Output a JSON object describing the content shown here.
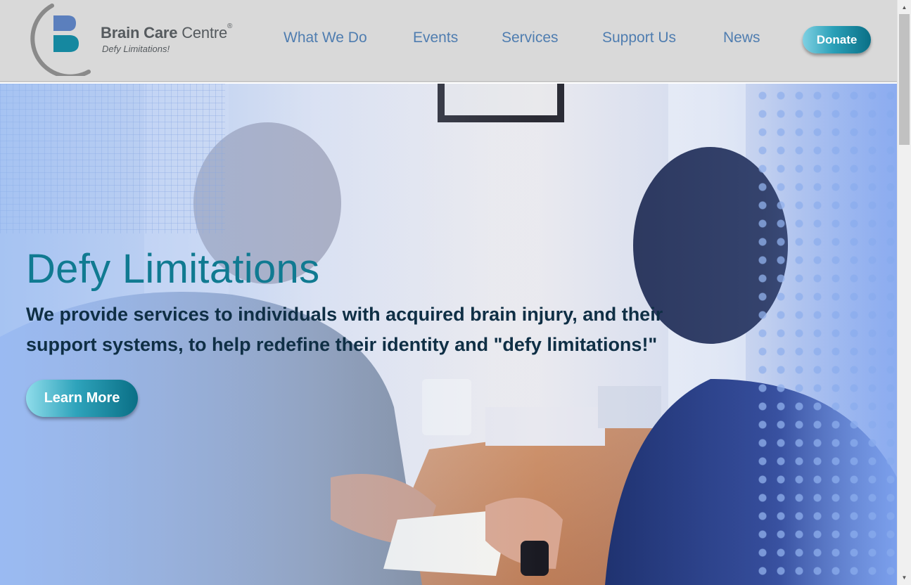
{
  "header": {
    "logo": {
      "name_bold": "Brain Care",
      "name_light": "Centre",
      "registered": "®",
      "tagline": "Defy Limitations!"
    },
    "nav": [
      {
        "label": "What We Do"
      },
      {
        "label": "Events"
      },
      {
        "label": "Services"
      },
      {
        "label": "Support Us"
      },
      {
        "label": "News"
      }
    ],
    "donate_label": "Donate"
  },
  "hero": {
    "title": "Defy Limitations",
    "subtitle": "We provide services to individuals with acquired brain injury, and their support systems, to help redefine their identity and \"defy limitations!\"",
    "cta_label": "Learn More"
  },
  "colors": {
    "header_bg": "#d9d9d9",
    "nav_text": "#4f7db0",
    "accent_teal": "#107a91",
    "hero_text_dark": "#0f2f45",
    "logo_blue": "#5b7fbd",
    "logo_teal": "#1588a0",
    "logo_arc_gray": "#8a8a8a"
  },
  "icons": {
    "scroll_up": "scroll-up-arrow-icon",
    "scroll_down": "scroll-down-arrow-icon",
    "logo_mark": "brain-care-logo-icon"
  }
}
